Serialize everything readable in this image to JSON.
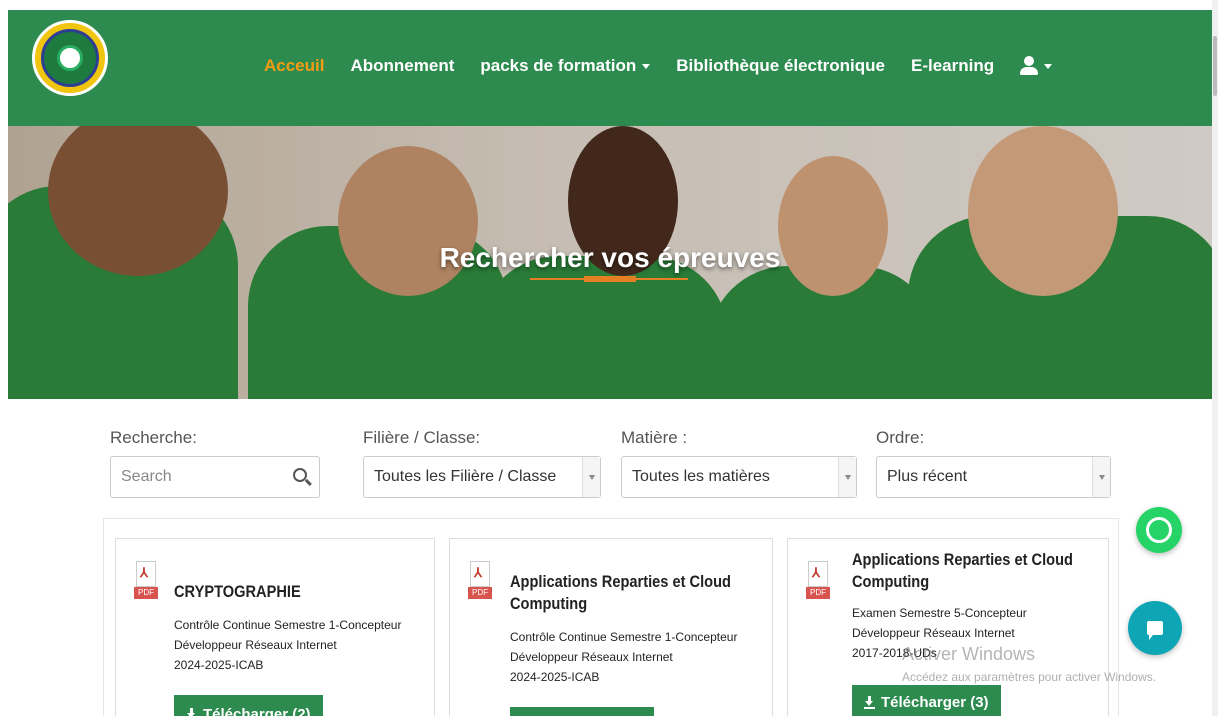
{
  "navbar": {
    "logo_text": "EPREUVE EXPRESS · TRAVAIL · SUCCES",
    "items": [
      {
        "label": "Acceuil",
        "active": true
      },
      {
        "label": "Abonnement",
        "active": false
      },
      {
        "label": "packs de formation",
        "active": false,
        "dropdown": true
      },
      {
        "label": "Bibliothèque électronique",
        "active": false
      },
      {
        "label": "E-learning",
        "active": false
      }
    ],
    "user_menu_icon": "user-icon"
  },
  "hero": {
    "title": "Rechercher vos épreuves"
  },
  "filters": {
    "search": {
      "label": "Recherche:",
      "placeholder": "Search"
    },
    "filiere": {
      "label": "Filière / Classe:",
      "value": "Toutes les Filière / Classe"
    },
    "matiere": {
      "label": "Matière :",
      "value": "Toutes les matières"
    },
    "ordre": {
      "label": "Ordre:",
      "value": "Plus récent"
    }
  },
  "results": [
    {
      "title_lines": [
        "CRYPTOGRAPHIE"
      ],
      "desc_lines": [
        "Contrôle Continue Semestre 1-Concepteur",
        "Développeur Réseaux Internet",
        "2024-2025-ICAB"
      ],
      "button": "Télécharger (2)"
    },
    {
      "title_lines": [
        "Applications Reparties et Cloud",
        "Computing"
      ],
      "desc_lines": [
        "Contrôle Continue Semestre 1-Concepteur",
        "Développeur Réseaux Internet",
        "2024-2025-ICAB"
      ],
      "button": ""
    },
    {
      "title_lines": [
        "Applications Reparties et Cloud",
        "Computing"
      ],
      "desc_lines": [
        "Examen Semestre 5-Concepteur",
        "Développeur Réseaux Internet",
        "2017-2018-UDs"
      ],
      "button": "Télécharger (3)"
    }
  ],
  "pdf_tag": "PDF",
  "watermark": {
    "title": "Activer Windows",
    "subtitle": "Accédez aux paramètres pour activer Windows."
  },
  "colors": {
    "primary_green": "#2e8b4f",
    "active_orange": "#f39c12",
    "whatsapp": "#25d366",
    "chat": "#0ea5b5",
    "pdf_red": "#d9534f"
  }
}
